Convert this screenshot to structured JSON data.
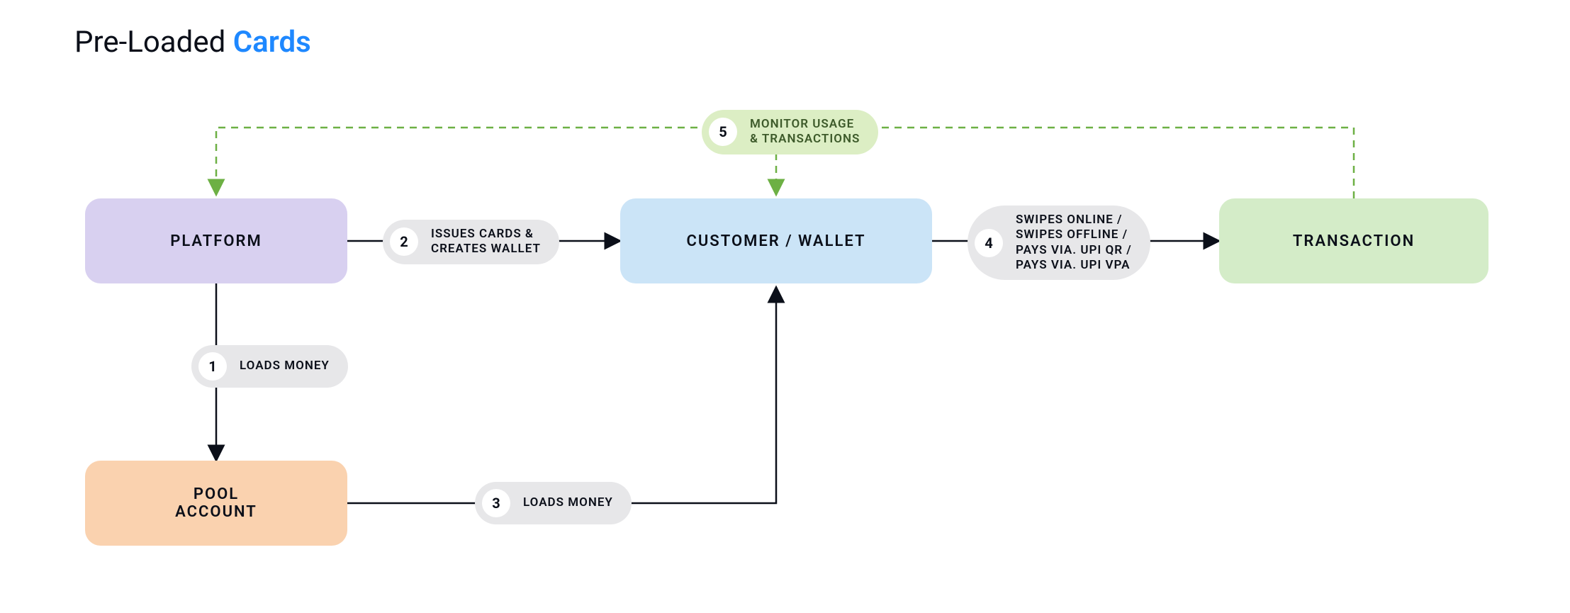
{
  "title": {
    "prefix": "Pre-Loaded ",
    "accent": "Cards"
  },
  "nodes": {
    "platform": "PLATFORM",
    "pool": "POOL\nACCOUNT",
    "customer": "CUSTOMER / WALLET",
    "txn": "TRANSACTION"
  },
  "steps": {
    "s1": {
      "num": "1",
      "label": "LOADS MONEY"
    },
    "s2": {
      "num": "2",
      "label": "ISSUES CARDS &\nCREATES WALLET"
    },
    "s3": {
      "num": "3",
      "label": "LOADS MONEY"
    },
    "s4": {
      "num": "4",
      "label": "SWIPES ONLINE /\nSWIPES OFFLINE /\nPAYS VIA. UPI QR /\nPAYS VIA. UPI VPA"
    },
    "s5": {
      "num": "5",
      "label": "MONITOR USAGE\n& TRANSACTIONS"
    }
  },
  "colors": {
    "platform": "#d8d0f0",
    "pool": "#fad2af",
    "customer": "#cbe4f7",
    "txn": "#d4ecc8",
    "pill": "#e7e7e9",
    "pillGreen": "#dceec4",
    "accent": "#1e88ff",
    "dashed": "#6db044"
  },
  "edges": [
    {
      "from": "platform",
      "to": "pool",
      "step": 1,
      "style": "solid"
    },
    {
      "from": "platform",
      "to": "customer",
      "step": 2,
      "style": "solid"
    },
    {
      "from": "pool",
      "to": "customer",
      "step": 3,
      "style": "solid"
    },
    {
      "from": "customer",
      "to": "txn",
      "step": 4,
      "style": "solid"
    },
    {
      "from": "txn",
      "to": "platform",
      "step": 5,
      "style": "dashed",
      "note": "monitor back-edge via customer"
    }
  ]
}
